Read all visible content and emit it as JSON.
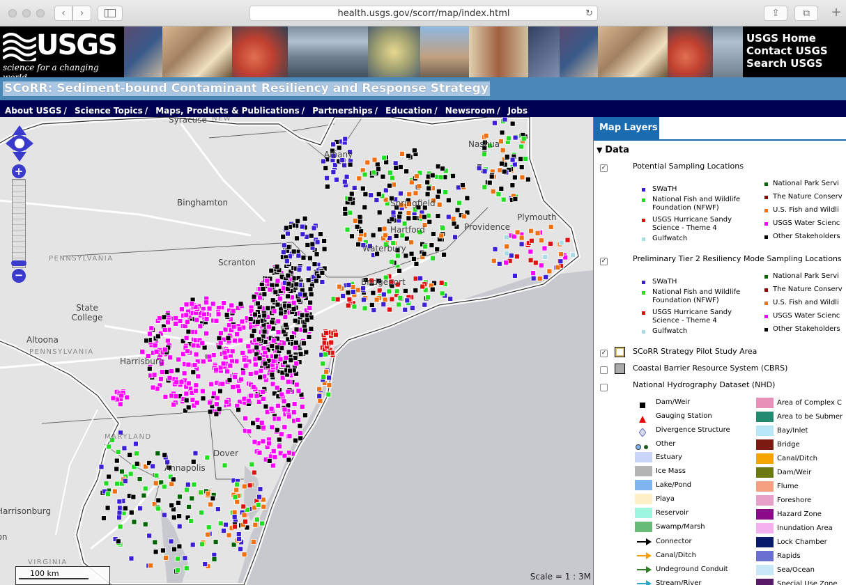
{
  "browser": {
    "url": "health.usgs.gov/scorr/map/index.html",
    "back_glyph": "‹",
    "forward_glyph": "›",
    "reload_glyph": "↻",
    "share_glyph": "⇪",
    "tabs_glyph": "⧉",
    "newtab_glyph": "+"
  },
  "header": {
    "logo_text": "USGS",
    "logo_tagline": "science for a changing world",
    "links": [
      "USGS Home",
      "Contact USGS",
      "Search USGS"
    ]
  },
  "title": "SCoRR: Sediment-bound Contaminant Resiliency and Response Strategy",
  "nav": [
    "About USGS",
    "Science Topics",
    "Maps, Products & Publications",
    "Partnerships",
    "Education",
    "Newsroom",
    "Jobs"
  ],
  "map": {
    "places": [
      "Syracuse",
      "Albany",
      "Nashua",
      "Binghamton",
      "Scranton",
      "State College",
      "Altoona",
      "Harrisburg",
      "Providence",
      "Plymouth",
      "Hartford",
      "Springfield",
      "Waterbury",
      "Bridgeport",
      "Dover",
      "Annapolis",
      "Harrisonburg",
      "Washington"
    ],
    "states": [
      "NEW",
      "PENNSYLVANIA",
      "PENNSYLVANIA",
      "MARYLAND",
      "VIRGINIA"
    ],
    "scale_bar": "100 km",
    "scale_text": "Scale = 1 : 3M",
    "zoom_in": "+",
    "zoom_out": "−"
  },
  "panel": {
    "tab": "Map Layers",
    "data_heading": "Data",
    "layers": [
      {
        "title": "Potential Sampling Locations",
        "checked": true
      },
      {
        "title": "Preliminary Tier 2 Resiliency Mode Sampling Locations",
        "checked": true
      },
      {
        "title": "SCoRR Strategy Pilot Study Area",
        "checked": true
      },
      {
        "title": "Coastal Barrier Resource System (CBRS)",
        "checked": false
      },
      {
        "title": "National Hydrography Dataset (NHD)",
        "checked": false
      }
    ],
    "sampling_left": [
      {
        "label": "SWaTH",
        "color": "#3b1fd6"
      },
      {
        "label": "National Fish and Wildlife Foundation  (NFWF)",
        "color": "#22dd22"
      },
      {
        "label": "USGS Hurricane Sandy Science - Theme 4",
        "color": "#e01010"
      },
      {
        "label": "Gulfwatch",
        "color": "#a8dde8"
      }
    ],
    "sampling_right": [
      {
        "label": "National Park Servi",
        "color": "#006400"
      },
      {
        "label": "The Nature Conserv",
        "color": "#8b0000"
      },
      {
        "label": "U.S. Fish and Wildli",
        "color": "#f07010"
      },
      {
        "label": "USGS Water Scienc",
        "color": "#ff00ff"
      },
      {
        "label": "Other Stakeholders",
        "color": "#000000"
      }
    ],
    "tier2_left": [
      {
        "label": "SWaTH",
        "color": "#3b1fd6"
      },
      {
        "label": "National Fish and Wildlife Foundation  (NFWF)",
        "color": "#22dd22"
      },
      {
        "label": "USGS Hurricane Sandy Science - Theme 4",
        "color": "#e01010"
      },
      {
        "label": "Gulfwatch",
        "color": "#a8dde8"
      }
    ],
    "tier2_right": [
      {
        "label": "National Park Servi",
        "color": "#006400"
      },
      {
        "label": "The Nature Conserv",
        "color": "#8b0000"
      },
      {
        "label": "U.S. Fish and Wildli",
        "color": "#f07010"
      },
      {
        "label": "USGS Water Scienc",
        "color": "#ff00ff"
      },
      {
        "label": "Other Stakeholders",
        "color": "#000000"
      }
    ],
    "nhd_points": [
      {
        "label": "Dam/Weir",
        "icon": "square-icon"
      },
      {
        "label": "Gauging Station",
        "icon": "triangle-icon"
      },
      {
        "label": "Divergence Structure",
        "icon": "diamond-icon"
      },
      {
        "label": "Other",
        "icon": "dots-icon"
      }
    ],
    "nhd_areas_left": [
      {
        "label": "Estuary",
        "color": "#c8d4f8"
      },
      {
        "label": "Ice Mass",
        "color": "#b4b4b4"
      },
      {
        "label": "Lake/Pond",
        "color": "#7eb4f0"
      },
      {
        "label": "Playa",
        "color": "#fff0c8"
      },
      {
        "label": "Reservoir",
        "color": "#9ef5e0"
      },
      {
        "label": "Swamp/Marsh",
        "color": "#66bb77"
      }
    ],
    "nhd_lines": [
      {
        "label": "Connector",
        "color": "#000000"
      },
      {
        "label": "Canal/Ditch",
        "color": "#f5a000"
      },
      {
        "label": "Undeground Conduit",
        "color": "#2e7d1e"
      },
      {
        "label": "Stream/River",
        "color": "#2aa8c8"
      }
    ],
    "nhd_areas_right": [
      {
        "label": "Area of Complex C",
        "color": "#e890b8"
      },
      {
        "label": "Area to be Submer",
        "color": "#238a70"
      },
      {
        "label": "Bay/Inlet",
        "color": "#b8e8f8"
      },
      {
        "label": "Bridge",
        "color": "#7a1a10"
      },
      {
        "label": "Canal/Ditch",
        "color": "#f5a500"
      },
      {
        "label": "Dam/Weir",
        "color": "#6a7a10"
      },
      {
        "label": "Flume",
        "color": "#f5a080"
      },
      {
        "label": "Foreshore",
        "color": "#e8a0c8"
      },
      {
        "label": "Hazard Zone",
        "color": "#8a0a8a"
      },
      {
        "label": "Inundation Area",
        "color": "#f5b0f0"
      },
      {
        "label": "Lock Chamber",
        "color": "#0a1a6a"
      },
      {
        "label": "Rapids",
        "color": "#6a70d0"
      },
      {
        "label": "Sea/Ocean",
        "color": "#c8e8f8"
      },
      {
        "label": "Special Use Zone",
        "color": "#5a1a6a"
      }
    ]
  }
}
